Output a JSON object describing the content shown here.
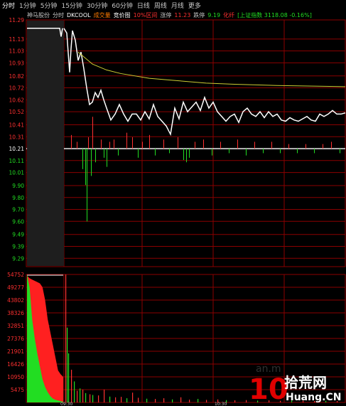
{
  "toolbar": {
    "items": [
      "分时",
      "1分钟",
      "5分钟",
      "15分钟",
      "30分钟",
      "60分钟",
      "日线",
      "周线",
      "月线",
      "更多"
    ],
    "active_index": 0
  },
  "info": {
    "stock_name": "神马股份",
    "view": "分时",
    "indicator": "DKCOOL",
    "volume_label": "成交量",
    "bid_label": "竞价图",
    "band_label": "10%区间",
    "limit_up_label": "涨停",
    "limit_up_value": "11.23",
    "limit_down_label": "跌停",
    "limit_down_value": "9.19",
    "turnover_label": "化纤",
    "index_label": "[上证指数 3118.08 -0.16%]"
  },
  "colors": {
    "up": "#ff3030",
    "down": "#22dd22",
    "price_line": "#ffffff",
    "avg_line": "#cccc33",
    "grid": "#8b0000",
    "axis_text": "#c8c8c8"
  },
  "chart_data": [
    {
      "type": "line",
      "title": "",
      "y_ticks": [
        "11.29",
        "11.13",
        "11.03",
        "10.93",
        "10.82",
        "10.72",
        "10.62",
        "10.52",
        "10.41",
        "10.31",
        "10.21",
        "10.11",
        "10.01",
        "9.90",
        "9.80",
        "9.70",
        "9.60",
        "9.49",
        "9.39",
        "9.29"
      ],
      "ylim": [
        9.22,
        11.29
      ],
      "base_price": 10.21,
      "series": [
        {
          "key": "price",
          "x": [
            0,
            2,
            4,
            5,
            6,
            8,
            10,
            12,
            14,
            16,
            18,
            20,
            22,
            24,
            26,
            28,
            30,
            33,
            36,
            39,
            42,
            45,
            48,
            51,
            54,
            57,
            60,
            63,
            66,
            69,
            72,
            75,
            78,
            81,
            84,
            87,
            90,
            93,
            96,
            99,
            102,
            105,
            108,
            111,
            114,
            117,
            120,
            123,
            126,
            129,
            132,
            135,
            138,
            141,
            144,
            147,
            150,
            153,
            156,
            159,
            162,
            165,
            168,
            171,
            174,
            177,
            180,
            183,
            186,
            189,
            192,
            195,
            198
          ],
          "values": [
            11.22,
            11.18,
            10.85,
            11.05,
            11.2,
            11.12,
            10.95,
            11.02,
            10.88,
            10.72,
            10.58,
            10.6,
            10.68,
            10.64,
            10.7,
            10.62,
            10.55,
            10.45,
            10.5,
            10.58,
            10.5,
            10.44,
            10.5,
            10.5,
            10.45,
            10.52,
            10.46,
            10.58,
            10.48,
            10.44,
            10.4,
            10.33,
            10.55,
            10.46,
            10.6,
            10.52,
            10.56,
            10.6,
            10.53,
            10.64,
            10.55,
            10.6,
            10.52,
            10.48,
            10.44,
            10.48,
            10.5,
            10.43,
            10.52,
            10.55,
            10.5,
            10.48,
            10.52,
            10.47,
            10.52,
            10.48,
            10.5,
            10.45,
            10.44,
            10.47,
            10.45,
            10.44,
            10.46,
            10.48,
            10.45,
            10.44,
            10.5,
            10.48,
            10.5,
            10.53,
            10.5,
            10.5,
            10.51
          ]
        },
        {
          "key": "average",
          "x": [
            10,
            20,
            30,
            40,
            60,
            80,
            100,
            120,
            150,
            198
          ],
          "values": [
            11.02,
            10.92,
            10.87,
            10.84,
            10.8,
            10.78,
            10.76,
            10.75,
            10.74,
            10.73
          ]
        }
      ],
      "indicator_bars": [
        {
          "x": 5,
          "v": 0.6
        },
        {
          "x": 9,
          "v": 0.3
        },
        {
          "x": 13,
          "v": -0.9
        },
        {
          "x": 15,
          "v": -1.6
        },
        {
          "x": 16,
          "v": -3.2
        },
        {
          "x": 17,
          "v": 0.5
        },
        {
          "x": 19,
          "v": -1.2
        },
        {
          "x": 20,
          "v": 1.4
        },
        {
          "x": 22,
          "v": -0.6
        },
        {
          "x": 26,
          "v": 0.4
        },
        {
          "x": 28,
          "v": -0.4
        },
        {
          "x": 30,
          "v": -0.8
        },
        {
          "x": 32,
          "v": 0.3
        },
        {
          "x": 35,
          "v": 0.4
        },
        {
          "x": 38,
          "v": -0.3
        },
        {
          "x": 44,
          "v": 0.7
        },
        {
          "x": 48,
          "v": 0.5
        },
        {
          "x": 52,
          "v": -0.4
        },
        {
          "x": 55,
          "v": 0.3
        },
        {
          "x": 60,
          "v": 0.6
        },
        {
          "x": 64,
          "v": -0.3
        },
        {
          "x": 70,
          "v": 0.4
        },
        {
          "x": 74,
          "v": -0.2
        },
        {
          "x": 80,
          "v": 0.5
        },
        {
          "x": 84,
          "v": -0.5
        },
        {
          "x": 86,
          "v": -0.6
        },
        {
          "x": 88,
          "v": -0.4
        },
        {
          "x": 92,
          "v": 0.3
        },
        {
          "x": 98,
          "v": 0.4
        },
        {
          "x": 104,
          "v": -0.3
        },
        {
          "x": 110,
          "v": 0.3
        },
        {
          "x": 116,
          "v": -0.2
        },
        {
          "x": 122,
          "v": 0.4
        },
        {
          "x": 128,
          "v": -0.3
        },
        {
          "x": 134,
          "v": 0.3
        },
        {
          "x": 140,
          "v": -0.2
        },
        {
          "x": 146,
          "v": 0.3
        },
        {
          "x": 152,
          "v": -0.2
        },
        {
          "x": 158,
          "v": 0.2
        },
        {
          "x": 164,
          "v": -0.2
        },
        {
          "x": 170,
          "v": 0.2
        },
        {
          "x": 176,
          "v": -0.2
        },
        {
          "x": 182,
          "v": 0.2
        },
        {
          "x": 188,
          "v": 0.3
        },
        {
          "x": 194,
          "v": -0.2
        }
      ]
    },
    {
      "type": "bar",
      "title": "",
      "y_ticks": [
        "54752",
        "49277",
        "43802",
        "38326",
        "32851",
        "27376",
        "21901",
        "16426",
        "10950",
        "5475"
      ],
      "ylim": [
        0,
        54752
      ],
      "auction_buy_ratio": [
        0.99,
        0.97,
        0.96,
        0.95,
        0.94,
        0.93,
        0.9,
        0.8,
        0.65,
        0.55,
        0.45,
        0.35,
        0.25,
        0.22,
        0.2
      ],
      "auction_sell_ratio": [
        0.0,
        0.1,
        0.35,
        0.5,
        0.62,
        0.72,
        0.82,
        0.88,
        0.92,
        0.95,
        0.97,
        0.98,
        0.985,
        0.99,
        0.995
      ],
      "volume_bars": [
        {
          "x": 1,
          "v": 54752,
          "d": "up"
        },
        {
          "x": 2,
          "v": 32000,
          "d": "down"
        },
        {
          "x": 3,
          "v": 21000,
          "d": "down"
        },
        {
          "x": 5,
          "v": 14000,
          "d": "up"
        },
        {
          "x": 7,
          "v": 9000,
          "d": "down"
        },
        {
          "x": 9,
          "v": 5000,
          "d": "up"
        },
        {
          "x": 11,
          "v": 6000,
          "d": "down"
        },
        {
          "x": 13,
          "v": 5500,
          "d": "up"
        },
        {
          "x": 15,
          "v": 4000,
          "d": "down"
        },
        {
          "x": 18,
          "v": 3500,
          "d": "up"
        },
        {
          "x": 20,
          "v": 3200,
          "d": "down"
        },
        {
          "x": 24,
          "v": 3000,
          "d": "up"
        },
        {
          "x": 28,
          "v": 5500,
          "d": "up"
        },
        {
          "x": 32,
          "v": 2500,
          "d": "down"
        },
        {
          "x": 36,
          "v": 2200,
          "d": "up"
        },
        {
          "x": 40,
          "v": 2400,
          "d": "up"
        },
        {
          "x": 44,
          "v": 1800,
          "d": "down"
        },
        {
          "x": 48,
          "v": 4200,
          "d": "up"
        },
        {
          "x": 52,
          "v": 2000,
          "d": "up"
        },
        {
          "x": 58,
          "v": 1600,
          "d": "down"
        },
        {
          "x": 64,
          "v": 1500,
          "d": "up"
        },
        {
          "x": 70,
          "v": 1800,
          "d": "up"
        },
        {
          "x": 76,
          "v": 1300,
          "d": "down"
        },
        {
          "x": 82,
          "v": 2200,
          "d": "up"
        },
        {
          "x": 88,
          "v": 1200,
          "d": "up"
        },
        {
          "x": 94,
          "v": 1500,
          "d": "down"
        },
        {
          "x": 100,
          "v": 1100,
          "d": "up"
        },
        {
          "x": 108,
          "v": 1300,
          "d": "up"
        },
        {
          "x": 114,
          "v": 1000,
          "d": "down"
        },
        {
          "x": 120,
          "v": 900,
          "d": "up"
        },
        {
          "x": 128,
          "v": 1000,
          "d": "up"
        },
        {
          "x": 136,
          "v": 800,
          "d": "down"
        },
        {
          "x": 144,
          "v": 900,
          "d": "up"
        },
        {
          "x": 152,
          "v": 700,
          "d": "up"
        },
        {
          "x": 160,
          "v": 800,
          "d": "down"
        },
        {
          "x": 168,
          "v": 700,
          "d": "up"
        },
        {
          "x": 176,
          "v": 600,
          "d": "up"
        },
        {
          "x": 184,
          "v": 700,
          "d": "down"
        },
        {
          "x": 192,
          "v": 600,
          "d": "up"
        }
      ],
      "x_tick_labels": [
        "09:30",
        "10:30"
      ]
    }
  ],
  "watermark": {
    "big_number": "10",
    "cn_text": "拾荒网",
    "site": "Huang.CN"
  }
}
